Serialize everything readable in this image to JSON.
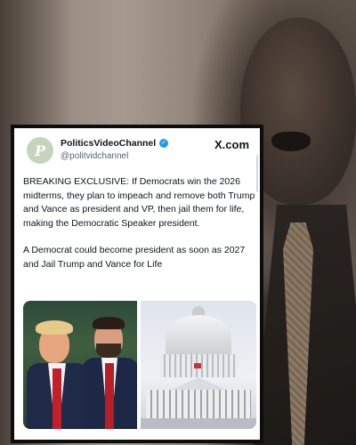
{
  "post": {
    "account_name": "PoliticsVideoChannel",
    "handle": "@politvidchannel",
    "avatar_letter": "P",
    "platform_logo": "X.com",
    "text_paragraphs": [
      "BREAKING EXCLUSIVE: If Democrats win the 2026 midterms, they plan to impeach and remove both Trump and Vance as president and VP, then jail them for life, making the Democratic Speaker president.",
      "A Democrat could become president as soon as 2027 and Jail Trump and Vance for Life"
    ],
    "verified_icon": "verified-badge-icon",
    "images": [
      "two-men-in-suits-photo",
      "us-capitol-photo"
    ]
  },
  "colors": {
    "verified": "#1d9bf0",
    "text": "#0f1419",
    "handle": "#536471"
  }
}
